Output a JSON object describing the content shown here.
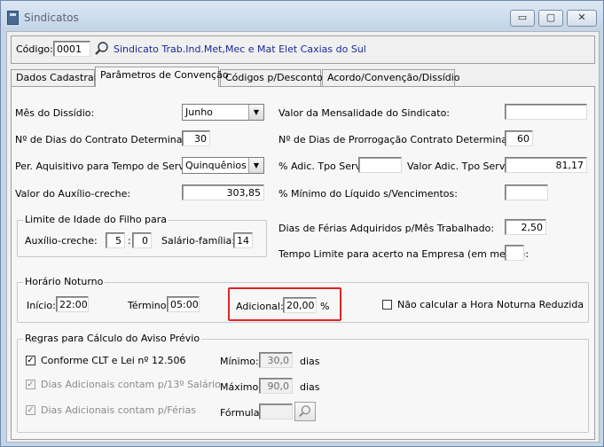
{
  "window": {
    "title": "Sindicatos",
    "buttons": {
      "minimize": "▭",
      "maximize": "▢",
      "close": "✕"
    }
  },
  "header": {
    "codigo_label": "Código:",
    "codigo_value": "0001",
    "sindicato_name": "Sindicato Trab.Ind.Met,Mec e Mat Elet Caxias do Sul"
  },
  "tabs": [
    {
      "label": "Dados Cadastrais",
      "active": false
    },
    {
      "label": "Parâmetros de Convenção",
      "active": true
    },
    {
      "label": "Códigos p/Descontos",
      "active": false
    },
    {
      "label": "Acordo/Convenção/Dissídio",
      "active": false
    }
  ],
  "params": {
    "mes_dissidio_label": "Mês do Dissídio:",
    "mes_dissidio_value": "Junho",
    "valor_mensalidade_label": "Valor da Mensalidade do Sindicato:",
    "valor_mensalidade_value": "",
    "dias_contrato_label": "Nº de Dias do Contrato Determinado:",
    "dias_contrato_value": "30",
    "dias_prorrogacao_label": "Nº de Dias de Prorrogação Contrato Determinado:",
    "dias_prorrogacao_value": "60",
    "per_aquisitivo_label": "Per. Aquisitivo para Tempo de Serviço:",
    "per_aquisitivo_value": "Quinquênios",
    "pct_adic_label": "% Adic. Tpo Serv.:",
    "pct_adic_value": "",
    "valor_adic_label": "Valor Adic. Tpo Serv.:",
    "valor_adic_value": "81,17",
    "auxilio_creche_label": "Valor do Auxílio-creche:",
    "auxilio_creche_value": "303,85",
    "pct_minimo_label": "% Mínimo do Líquido s/Vencimentos:",
    "pct_minimo_value": "",
    "dias_ferias_label": "Dias de Férias Adquiridos p/Mês Trabalhado:",
    "dias_ferias_value": "2,50",
    "tempo_limite_label": "Tempo Limite para acerto na Empresa (em meses):",
    "tempo_limite_value": ""
  },
  "limite_idade": {
    "title": "Limite de Idade do Filho para",
    "auxilio_label": "Auxílio-creche:",
    "auxilio_anos": "5",
    "separator": ":",
    "auxilio_meses": "0",
    "salario_label": "Salário-família:",
    "salario_value": "14"
  },
  "horario_noturno": {
    "title": "Horário Noturno",
    "inicio_label": "Início:",
    "inicio_value": "22:00",
    "termino_label": "Término:",
    "termino_value": "05:00",
    "adicional_label": "Adicional:",
    "adicional_value": "20,00",
    "adicional_unit": "%",
    "nao_calcular_label": "Não calcular a Hora Noturna Reduzida",
    "nao_calcular_checked": false
  },
  "aviso_previo": {
    "title": "Regras para Cálculo do Aviso Prévio",
    "clt_label": "Conforme CLT e Lei nº 12.506",
    "clt_checked": true,
    "dias_13_label": "Dias Adicionais contam p/13º Salário",
    "dias_13_checked": true,
    "dias_ferias_label": "Dias Adicionais contam p/Férias",
    "dias_ferias_checked": true,
    "minimo_label": "Mínimo:",
    "minimo_value": "30,0",
    "minimo_unit": "dias",
    "maximo_label": "Máximo:",
    "maximo_value": "90,0",
    "maximo_unit": "dias",
    "formula_label": "Fórmula:",
    "formula_value": ""
  },
  "colors": {
    "highlight": "#e02424",
    "link_blue": "#1a2a9a"
  },
  "icons": {
    "lookup": "magnifier-icon",
    "window": "app-icon"
  }
}
